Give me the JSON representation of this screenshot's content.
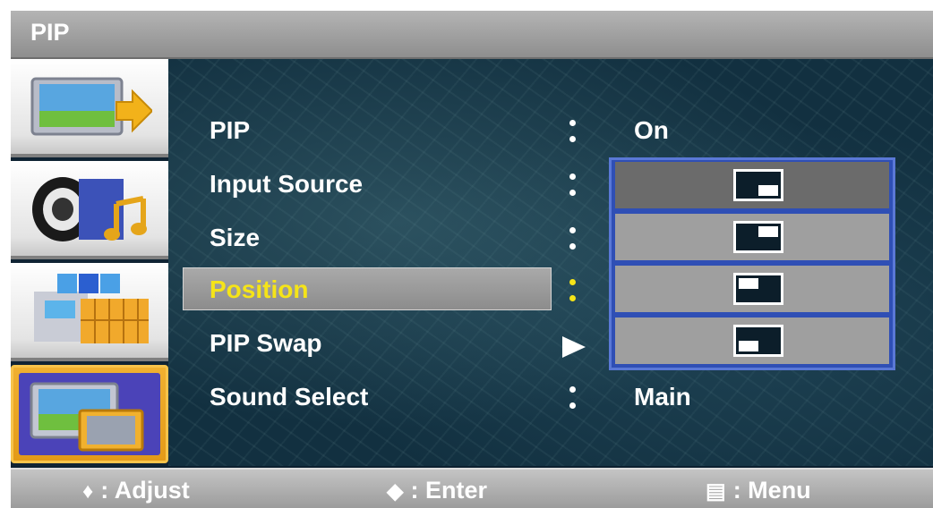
{
  "title": "PIP",
  "sidebar": {
    "items": [
      {
        "icon": "picture-setup-icon",
        "active": false
      },
      {
        "icon": "sound-icon",
        "active": false
      },
      {
        "icon": "channel-icon",
        "active": false
      },
      {
        "icon": "pip-setup-icon",
        "active": true
      }
    ]
  },
  "menu": {
    "rows": [
      {
        "label": "PIP",
        "value": "On"
      },
      {
        "label": "Input Source",
        "value": ""
      },
      {
        "label": "Size",
        "value": ""
      },
      {
        "label": "Position",
        "value": "",
        "selected": true
      },
      {
        "label": "PIP Swap",
        "value": ""
      },
      {
        "label": "Sound Select",
        "value": "Main"
      }
    ]
  },
  "position_options": [
    {
      "name": "bottom-right",
      "current": true
    },
    {
      "name": "top-right",
      "current": false
    },
    {
      "name": "top-left",
      "current": false
    },
    {
      "name": "bottom-left",
      "current": false
    }
  ],
  "footer": {
    "adjust": {
      "icon": "up-down-icon",
      "label": ": Adjust"
    },
    "enter": {
      "icon": "left-right-icon",
      "label": ": Enter"
    },
    "menu": {
      "icon": "menu-icon",
      "label": ": Menu"
    }
  },
  "colors": {
    "selected_text": "#f5e418",
    "list_border": "#2f4fb5",
    "active_tile": "#e39a18"
  }
}
